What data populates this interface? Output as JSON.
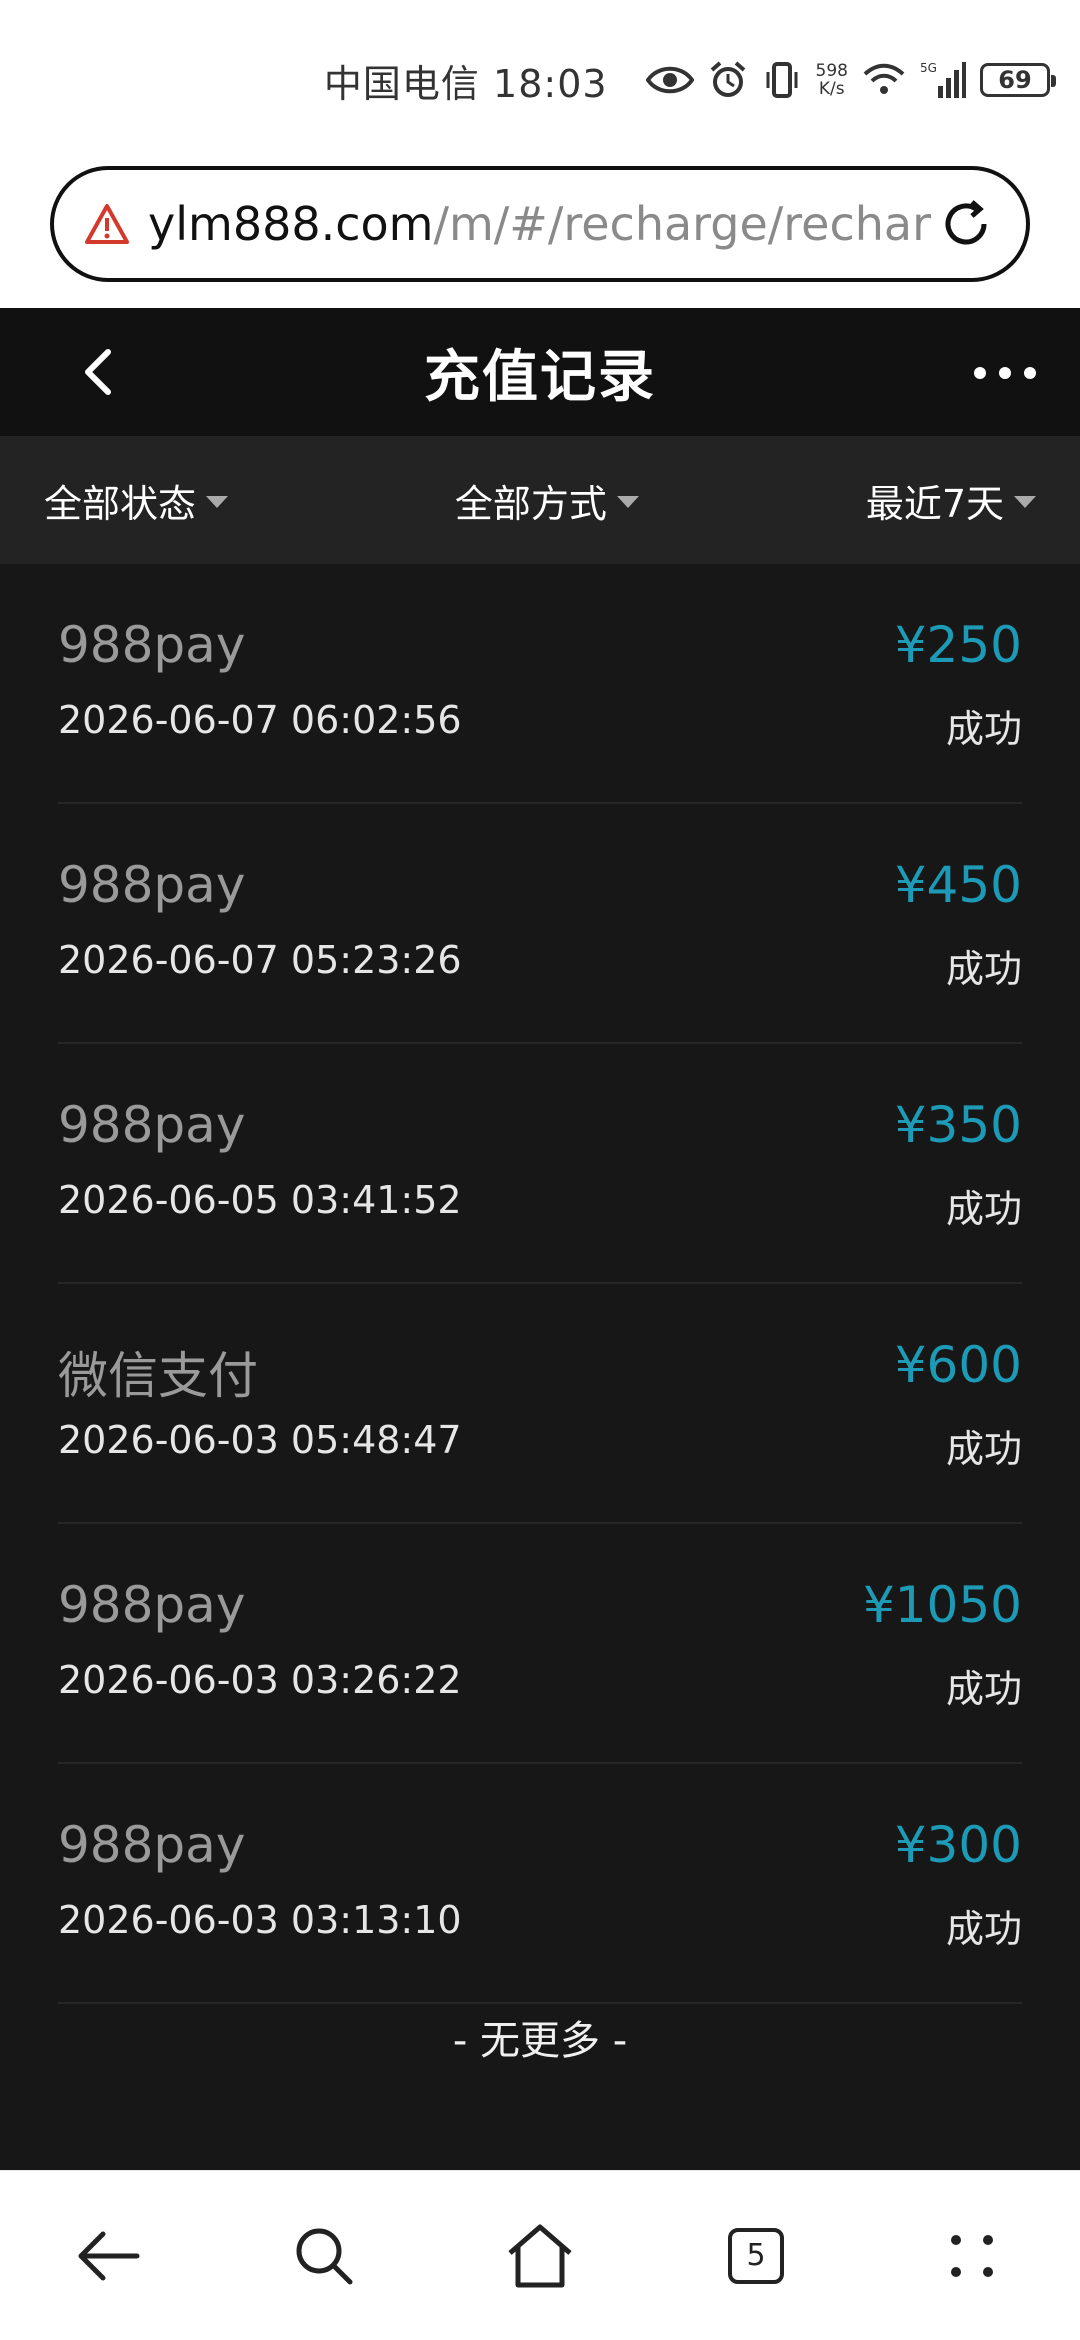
{
  "status_bar": {
    "carrier": "中国电信",
    "time": "18:03",
    "net_speed_value": "598",
    "net_speed_unit": "K/s",
    "battery": "69"
  },
  "browser": {
    "url_host": "ylm888.com",
    "url_path": "/m/#/recharge/rechar"
  },
  "page": {
    "title": "充值记录"
  },
  "filters": {
    "status": "全部状态",
    "method": "全部方式",
    "range": "最近7天"
  },
  "records": [
    {
      "method": "988pay",
      "time": "2026-06-07 06:02:56",
      "amount": "¥250",
      "status": "成功"
    },
    {
      "method": "988pay",
      "time": "2026-06-07 05:23:26",
      "amount": "¥450",
      "status": "成功"
    },
    {
      "method": "988pay",
      "time": "2026-06-05 03:41:52",
      "amount": "¥350",
      "status": "成功"
    },
    {
      "method": "微信支付",
      "time": "2026-06-03 05:48:47",
      "amount": "¥600",
      "status": "成功"
    },
    {
      "method": "988pay",
      "time": "2026-06-03 03:26:22",
      "amount": "¥1050",
      "status": "成功"
    },
    {
      "method": "988pay",
      "time": "2026-06-03 03:13:10",
      "amount": "¥300",
      "status": "成功"
    }
  ],
  "list_end": "- 无更多 -",
  "browser_nav": {
    "tab_count": "5"
  },
  "colors": {
    "amount": "#1d9bb6",
    "background": "#171717",
    "warning": "#d33a2c"
  },
  "icons": {
    "url_warning": "warning-triangle-icon",
    "reload": "reload-icon",
    "back": "chevron-left-icon",
    "more": "more-dots-icon"
  }
}
